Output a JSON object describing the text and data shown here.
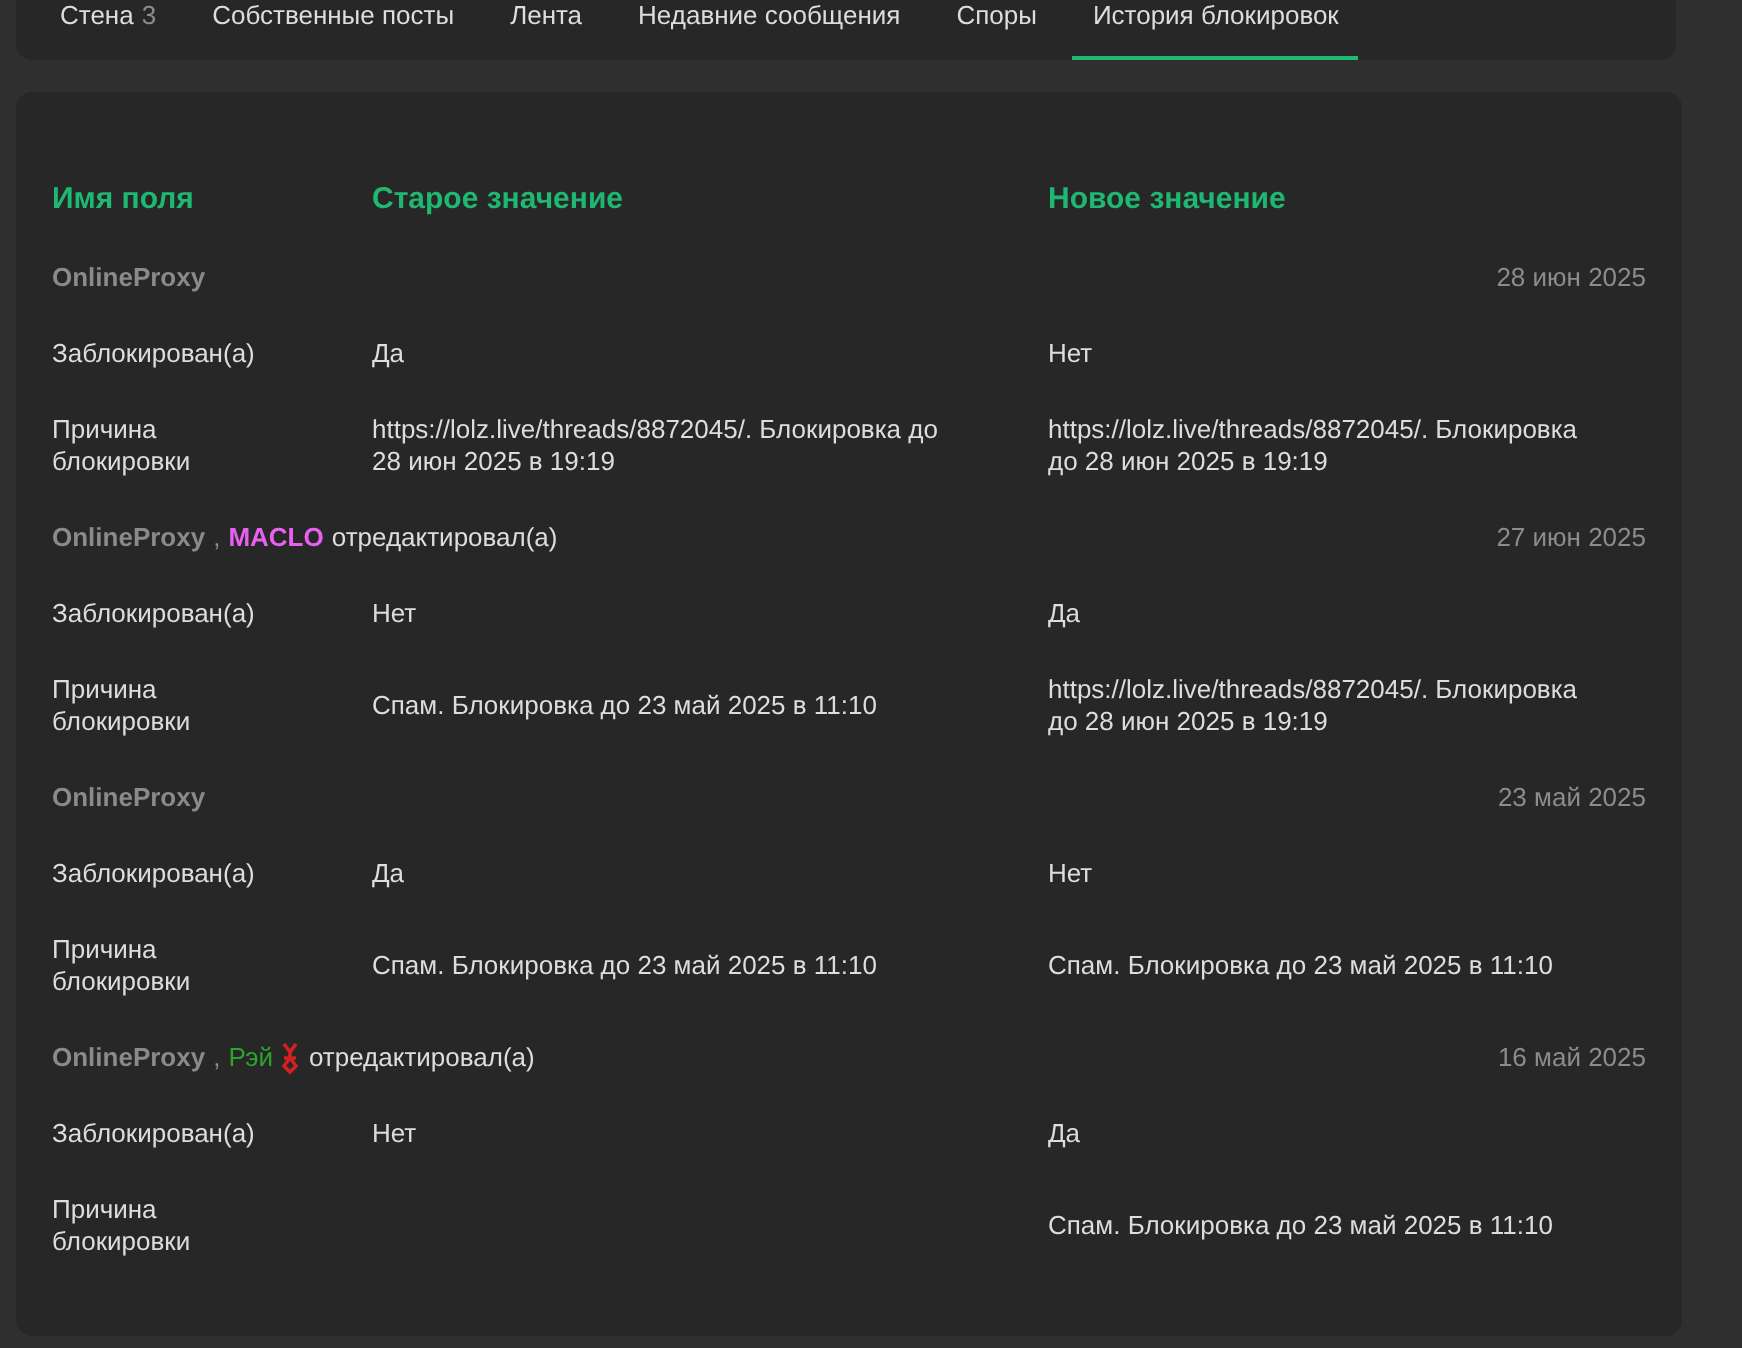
{
  "tabs": [
    {
      "label": "Стена",
      "count": "3",
      "selected": false
    },
    {
      "label": "Собственные посты",
      "selected": false
    },
    {
      "label": "Лента",
      "selected": false
    },
    {
      "label": "Недавние сообщения",
      "selected": false
    },
    {
      "label": "Споры",
      "selected": false
    },
    {
      "label": "История блокировок",
      "selected": true
    }
  ],
  "table": {
    "columns": [
      "Имя поля",
      "Старое значение",
      "Новое значение"
    ],
    "groups": [
      {
        "user": "OnlineProxy",
        "date": "28 июн 2025",
        "rows": [
          {
            "field": "Заблокирован(а)",
            "old": "Да",
            "new": "Нет"
          },
          {
            "field": "Причина блокировки",
            "old": "https://lolz.live/threads/8872045/. Блокировка до 28 июн 2025 в 19:19",
            "new": "https://lolz.live/threads/8872045/. Блокировка до 28 июн 2025 в 19:19"
          }
        ]
      },
      {
        "user": "OnlineProxy",
        "separator": ",",
        "editor": {
          "name": "MACLO",
          "color": "#e860f0",
          "bold": true
        },
        "action": "отредактировал(а)",
        "date": "27 июн 2025",
        "rows": [
          {
            "field": "Заблокирован(а)",
            "old": "Нет",
            "new": "Да"
          },
          {
            "field": "Причина блокировки",
            "old": "Спам. Блокировка до 23 май 2025 в 11:10",
            "new": "https://lolz.live/threads/8872045/. Блокировка до 28 июн 2025 в 19:19"
          }
        ]
      },
      {
        "user": "OnlineProxy",
        "date": "23 май 2025",
        "rows": [
          {
            "field": "Заблокирован(а)",
            "old": "Да",
            "new": "Нет"
          },
          {
            "field": "Причина блокировки",
            "old": "Спам. Блокировка до 23 май 2025 в 11:10",
            "new": "Спам. Блокировка до 23 май 2025 в 11:10"
          }
        ]
      },
      {
        "user": "OnlineProxy",
        "separator": ",",
        "editor": {
          "name": "Рэй",
          "color": "#2aa52a",
          "bold": false,
          "badge": true
        },
        "action": "отредактировал(а)",
        "date": "16 май 2025",
        "rows": [
          {
            "field": "Заблокирован(а)",
            "old": "Нет",
            "new": "Да"
          },
          {
            "field": "Причина блокировки",
            "new": "Спам. Блокировка до 23 май 2025 в 11:10"
          }
        ]
      }
    ]
  }
}
